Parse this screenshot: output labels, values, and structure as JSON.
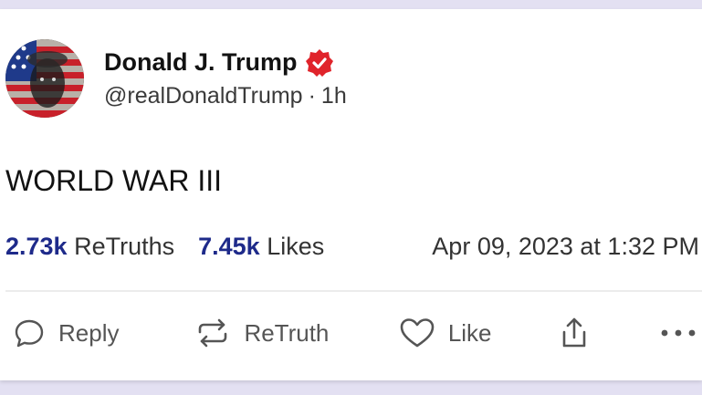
{
  "author": {
    "display_name": "Donald J. Trump",
    "handle": "@realDonaldTrump",
    "separator": "·",
    "time_ago": "1h",
    "verified_icon": "verified-badge-icon",
    "verified_color": "#e0242b"
  },
  "post": {
    "text": "WORLD WAR III"
  },
  "stats": {
    "retruths_count": "2.73k",
    "retruths_label": "ReTruths",
    "likes_count": "7.45k",
    "likes_label": "Likes",
    "timestamp": "Apr 09, 2023 at 1:32 PM",
    "count_color": "#1e2a8a"
  },
  "actions": {
    "reply_label": "Reply",
    "reply_icon": "reply-icon",
    "retruth_label": "ReTruth",
    "retruth_icon": "retruth-icon",
    "like_label": "Like",
    "like_icon": "heart-icon",
    "share_icon": "share-icon",
    "more_icon": "more-icon"
  }
}
